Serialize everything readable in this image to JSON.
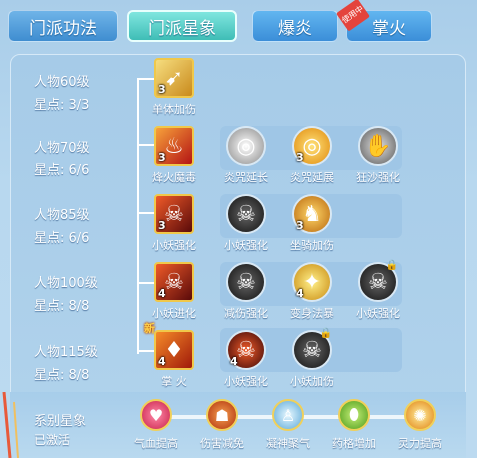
{
  "tabs": [
    {
      "label": "门派功法"
    },
    {
      "label": "门派星象"
    },
    {
      "label": "爆炎"
    },
    {
      "label": "掌火"
    }
  ],
  "ribbon": "使用中",
  "rows": [
    {
      "level": "人物60级",
      "stars": "星点: 3/3"
    },
    {
      "level": "人物70级",
      "stars": "星点: 6/6"
    },
    {
      "level": "人物85级",
      "stars": "星点: 6/6"
    },
    {
      "level": "人物100级",
      "stars": "星点: 8/8"
    },
    {
      "level": "人物115级",
      "stars": "星点: 8/8"
    }
  ],
  "skills": {
    "r1": [
      {
        "label": "单体加伤",
        "num": "3"
      }
    ],
    "r2": [
      {
        "label": "烽火魔毒",
        "num": "3"
      },
      {
        "label": "炎咒延长",
        "num": ""
      },
      {
        "label": "炎咒延展",
        "num": "3"
      },
      {
        "label": "狂沙强化",
        "num": ""
      }
    ],
    "r3": [
      {
        "label": "小妖强化",
        "num": "3"
      },
      {
        "label": "小妖强化",
        "num": ""
      },
      {
        "label": "坐骑加伤",
        "num": "3"
      }
    ],
    "r4": [
      {
        "label": "小妖进化",
        "num": "4"
      },
      {
        "label": "减伤强化",
        "num": ""
      },
      {
        "label": "变身法暴",
        "num": "4"
      },
      {
        "label": "小妖强化",
        "num": ""
      }
    ],
    "r5": [
      {
        "label": "掌 火",
        "num": "4"
      },
      {
        "label": "小妖强化",
        "num": "4"
      },
      {
        "label": "小妖加伤",
        "num": ""
      }
    ]
  },
  "new_tag": "新",
  "series": {
    "title": "系别星象",
    "status": "已激活"
  },
  "effects": [
    {
      "label": "气血提高"
    },
    {
      "label": "伤害减免"
    },
    {
      "label": "凝神聚气"
    },
    {
      "label": "药格增加"
    },
    {
      "label": "灵力提高"
    }
  ]
}
